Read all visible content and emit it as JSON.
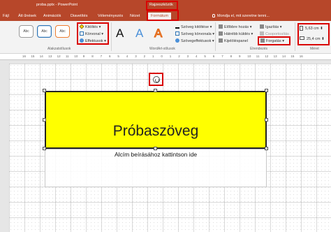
{
  "window": {
    "doc_title": "proba.pptx - PowerPoint",
    "context_group": "Rajzeszközök"
  },
  "tabs": [
    {
      "label": "Fájl"
    },
    {
      "label": "Átt űnések"
    },
    {
      "label": "Animációk"
    },
    {
      "label": "Diavetítés"
    },
    {
      "label": "Véleményezés"
    },
    {
      "label": "Nézet"
    },
    {
      "label": "Formátum",
      "active": true
    }
  ],
  "tell_me": "Mondja el, mit szeretne tenni...",
  "ribbon": {
    "shape_styles": {
      "group_label": "Alakzatstílusok",
      "samples": [
        "Abc",
        "Abc",
        "Abc"
      ],
      "fill": "Kitöltés",
      "outline": "Körvonal",
      "effects": "Effektusok"
    },
    "wordart": {
      "group_label": "WordArt-stílusok",
      "samples": [
        "A",
        "A",
        "A"
      ],
      "text_fill": "Szöveg kitöltése",
      "text_outline": "Szöveg körvonala",
      "text_effects": "Szövegeffektusok"
    },
    "arrange": {
      "group_label": "Elrendezés",
      "bring_forward": "Előbbre hozás",
      "send_backward": "Hátrébb küldés",
      "selection_pane": "Kijelöléspanel",
      "align": "Igazítás",
      "group": "Csoportosítás",
      "rotate": "Forgatás"
    },
    "size": {
      "group_label": "Méret",
      "height": "5,63 cm",
      "width": "25,4 cm"
    }
  },
  "ruler": {
    "ticks": [
      "16",
      "15",
      "14",
      "13",
      "12",
      "11",
      "10",
      "9",
      "8",
      "7",
      "6",
      "5",
      "4",
      "3",
      "2",
      "1",
      "0",
      "1",
      "2",
      "3",
      "4",
      "5",
      "6",
      "7",
      "8",
      "9",
      "10",
      "11",
      "12",
      "13",
      "14",
      "15",
      "16"
    ]
  },
  "slide": {
    "title_text": "Próbaszöveg",
    "subtitle_placeholder": "Alcím beírásához kattintson ide"
  },
  "colors": {
    "accent": "#b7472a",
    "highlight": "#d90000",
    "shape_fill": "#ffff00"
  }
}
